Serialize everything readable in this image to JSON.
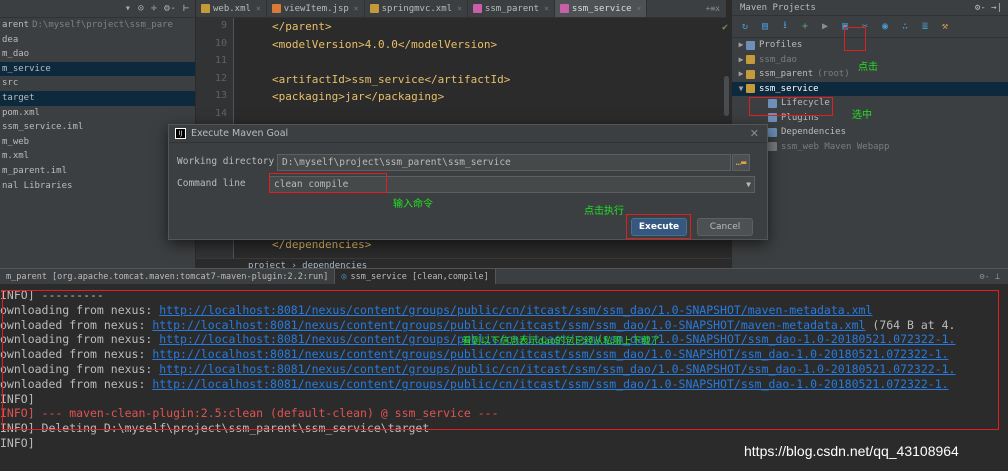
{
  "project_panel": {
    "toolbar_icons": [
      "chevron-down-icon",
      "target-icon",
      "split-icon",
      "gear-icon",
      "hide-icon"
    ],
    "items": [
      {
        "label": "arent",
        "path": "D:\\myself\\project\\ssm_pare",
        "selected": false
      },
      {
        "label": "dea",
        "selected": false
      },
      {
        "label": "m_dao",
        "selected": false
      },
      {
        "label": "m_service",
        "selected": true
      },
      {
        "label": "src",
        "selected": false
      },
      {
        "label": "target",
        "selected": true
      },
      {
        "label": "pom.xml",
        "selected": false
      },
      {
        "label": "ssm_service.iml",
        "selected": false
      },
      {
        "label": "m_web",
        "selected": false
      },
      {
        "label": "m.xml",
        "selected": false
      },
      {
        "label": "m_parent.iml",
        "selected": false
      },
      {
        "label": "nal Libraries",
        "selected": false
      }
    ]
  },
  "tabs": [
    {
      "label": "web.xml",
      "color": "#c49a3a",
      "active": false
    },
    {
      "label": "viewItem.jsp",
      "color": "#d97a3a",
      "active": false
    },
    {
      "label": "springmvc.xml",
      "color": "#c49a3a",
      "active": false
    },
    {
      "label": "ssm_parent",
      "color": "#c85fa8",
      "active": false
    },
    {
      "label": "ssm_service",
      "color": "#c85fa8",
      "active": true
    }
  ],
  "tab_overflow": "+≡x",
  "editor": {
    "lines": [
      {
        "n": "9",
        "text": "</parent>"
      },
      {
        "n": "10",
        "text": "<modelVersion>4.0.0</modelVersion>"
      },
      {
        "n": "11",
        "text": ""
      },
      {
        "n": "12",
        "text": "<artifactId>ssm_service</artifactId>"
      },
      {
        "n": "13",
        "text": "<packaging>jar</packaging>"
      },
      {
        "n": "14",
        "text": ""
      }
    ],
    "bottom_line": "</dependencies>",
    "breadcrumb": "project  ›  dependencies"
  },
  "maven": {
    "title": "Maven Projects",
    "title_icons": "⚙- →|",
    "toolbar": [
      {
        "name": "refresh-icon",
        "glyph": "↻",
        "tone": "blue"
      },
      {
        "name": "generate-icon",
        "glyph": "▤",
        "tone": "blue"
      },
      {
        "name": "download-icon",
        "glyph": "⭳",
        "tone": "blue"
      },
      {
        "name": "add-icon",
        "glyph": "+",
        "tone": "green"
      },
      {
        "name": "run-icon",
        "glyph": "▶",
        "tone": "grey"
      },
      {
        "name": "execute-goal-icon",
        "glyph": "▣",
        "tone": "blue"
      },
      {
        "name": "toggle-offline-icon",
        "glyph": "✂",
        "tone": "blue"
      },
      {
        "name": "skip-tests-icon",
        "glyph": "◉",
        "tone": "blue"
      },
      {
        "name": "show-dependencies-icon",
        "glyph": "∴",
        "tone": "blue"
      },
      {
        "name": "collapse-icon",
        "glyph": "≣",
        "tone": "blue"
      },
      {
        "name": "settings-icon",
        "glyph": "⚒",
        "tone": "orange"
      }
    ],
    "tree": [
      {
        "label": "Profiles",
        "expanded": false,
        "indent": 0,
        "dim": "",
        "selected": false,
        "muted": false
      },
      {
        "label": "ssm_dao",
        "expanded": false,
        "indent": 0,
        "dim": "",
        "selected": false,
        "muted": true
      },
      {
        "label": "ssm_parent",
        "expanded": false,
        "indent": 0,
        "dim": "(root)",
        "selected": false,
        "muted": false
      },
      {
        "label": "ssm_service",
        "expanded": true,
        "indent": 0,
        "dim": "",
        "selected": true,
        "muted": false
      },
      {
        "label": "Lifecycle",
        "expanded": false,
        "indent": 1,
        "dim": "",
        "selected": false,
        "muted": false
      },
      {
        "label": "Plugins",
        "expanded": false,
        "indent": 1,
        "dim": "",
        "selected": false,
        "muted": false
      },
      {
        "label": "Dependencies",
        "expanded": false,
        "indent": 1,
        "dim": "",
        "selected": false,
        "muted": false
      },
      {
        "label": "ssm_web Maven Webapp",
        "expanded": false,
        "indent": 1,
        "dim": "",
        "selected": false,
        "muted": true
      }
    ]
  },
  "dialog": {
    "title": "Execute Maven Goal",
    "working_dir_label": "Working directory",
    "working_dir_value": "D:\\myself\\project\\ssm_parent\\ssm_service",
    "command_label": "Command line",
    "command_value": "clean compile",
    "execute_label": "Execute",
    "cancel_label": "Cancel"
  },
  "run": {
    "tab_left": "m_parent [org.apache.tomcat.maven:tomcat7-maven-plugin:2.2:run]",
    "tab_active": "ssm_service [clean,compile]",
    "lines": [
      {
        "prefix": "INFO] ---------",
        "link": "",
        "suffix": ""
      },
      {
        "prefix": "ownloading from nexus: ",
        "link": "http://localhost:8081/nexus/content/groups/public/cn/itcast/ssm/ssm_dao/1.0-SNAPSHOT/maven-metadata.xml",
        "suffix": ""
      },
      {
        "prefix": "ownloaded from nexus: ",
        "link": "http://localhost:8081/nexus/content/groups/public/cn/itcast/ssm/ssm_dao/1.0-SNAPSHOT/maven-metadata.xml",
        "suffix": " (764 B at 4."
      },
      {
        "prefix": "ownloading from nexus: ",
        "link": "http://localhost:8081/nexus/content/groups/public/cn/itcast/ssm/ssm_dao/1.0-SNAPSHOT/ssm_dao-1.0-20180521.072322-1.",
        "suffix": ""
      },
      {
        "prefix": "ownloaded from nexus: ",
        "link": "http://localhost:8081/nexus/content/groups/public/cn/itcast/ssm/ssm_dao/1.0-SNAPSHOT/ssm_dao-1.0-20180521.072322-1.",
        "suffix": ""
      },
      {
        "prefix": "ownloading from nexus: ",
        "link": "http://localhost:8081/nexus/content/groups/public/cn/itcast/ssm/ssm_dao/1.0-SNAPSHOT/ssm_dao-1.0-20180521.072322-1.",
        "suffix": ""
      },
      {
        "prefix": "ownloaded from nexus: ",
        "link": "http://localhost:8081/nexus/content/groups/public/cn/itcast/ssm/ssm_dao/1.0-SNAPSHOT/ssm_dao-1.0-20180521.072322-1.",
        "suffix": ""
      },
      {
        "prefix": "INFO]",
        "link": "",
        "suffix": ""
      },
      {
        "prefix": "INFO] --- maven-clean-plugin:2.5:clean (default-clean) @ ssm_service ---",
        "link": "",
        "suffix": ""
      },
      {
        "prefix": "INFO] Deleting D:\\myself\\project\\ssm_parent\\ssm_service\\target",
        "link": "",
        "suffix": ""
      },
      {
        "prefix": "INFO]",
        "link": "",
        "suffix": ""
      }
    ]
  },
  "annotations": {
    "click": "点击",
    "select": "选中",
    "type_command": "输入命令",
    "click_execute": "点击执行",
    "log_note": "看到以下信息表示dao的包已经从私服上下载了"
  },
  "watermark": "https://blog.csdn.net/qq_43108964"
}
